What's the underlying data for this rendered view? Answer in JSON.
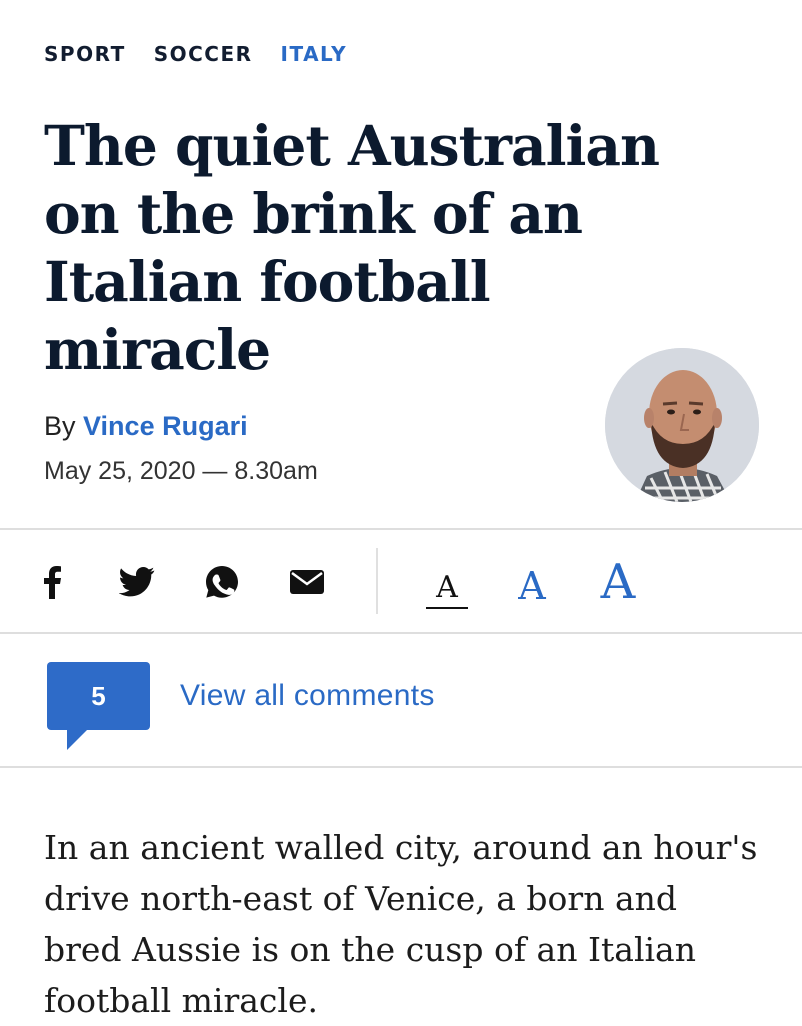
{
  "breadcrumbs": [
    {
      "label": "SPORT",
      "active": false
    },
    {
      "label": "SOCCER",
      "active": false
    },
    {
      "label": "ITALY",
      "active": true
    }
  ],
  "headline": "The quiet Australian on the brink of an Italian football miracle",
  "byline": {
    "prefix": "By",
    "author": "Vince Rugari",
    "date": "May 25, 2020 — 8.30am"
  },
  "share": {
    "icons": [
      "facebook-icon",
      "twitter-icon",
      "whatsapp-icon",
      "email-icon"
    ],
    "font_size_labels": {
      "small": "A",
      "medium": "A",
      "large": "A"
    },
    "selected_font_size": "small"
  },
  "comments": {
    "count": "5",
    "link_text": "View all comments"
  },
  "article": {
    "first_paragraph": "In an ancient walled city, around an hour's drive north-east of Venice, a born and bred Aussie is on the cusp of an Italian football miracle."
  },
  "colors": {
    "accent": "#2a6ac5",
    "headline": "#0c1a2e",
    "comment_bubble": "#2e6bc8"
  }
}
